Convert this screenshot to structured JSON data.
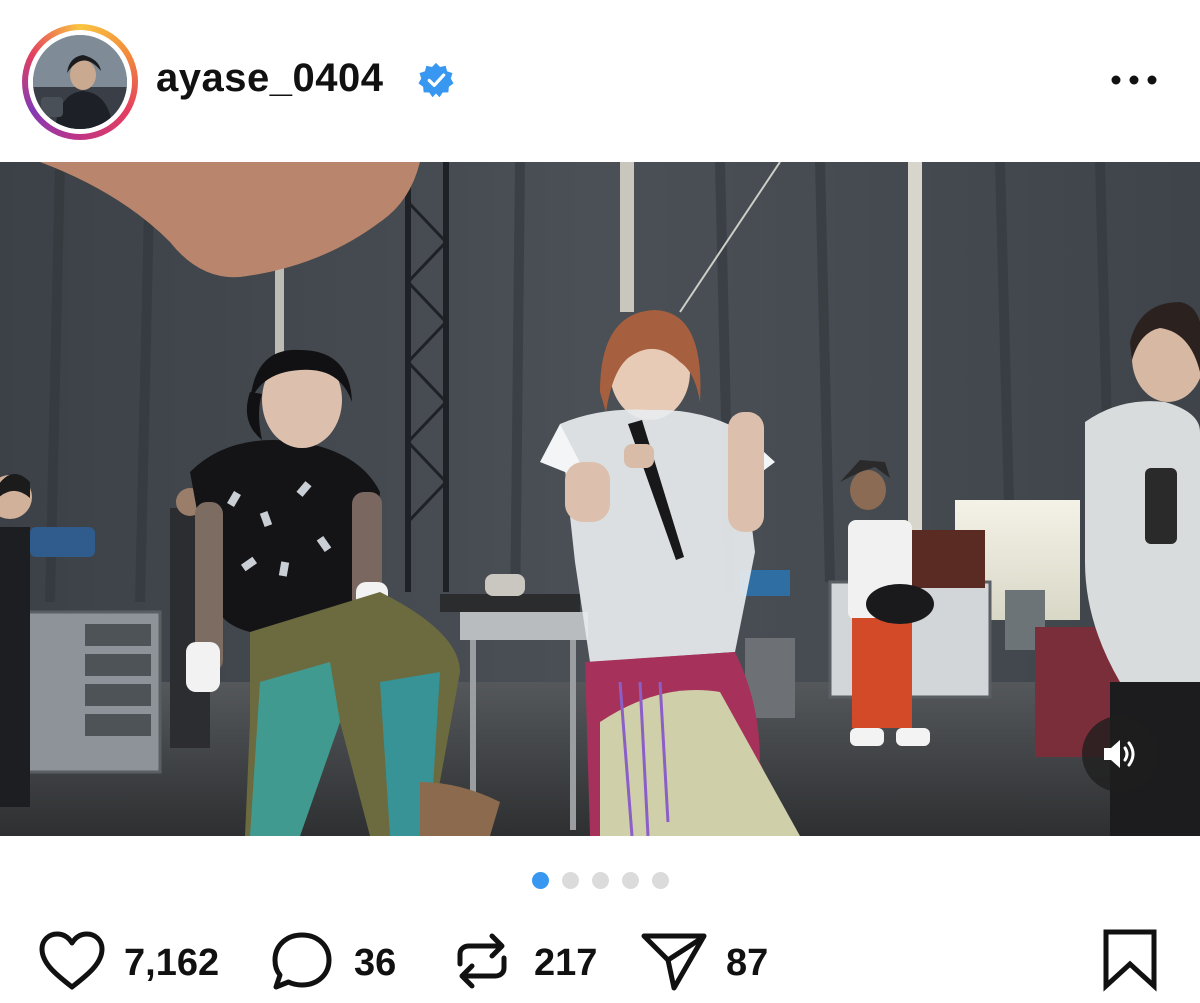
{
  "post": {
    "username": "ayase_0404",
    "verified": true,
    "avatar_icon": "profile-avatar",
    "more_icon": "more-horizontal-icon"
  },
  "media": {
    "type": "video",
    "sound_icon": "speaker-on-icon",
    "carousel": {
      "count": 5,
      "active_index": 0
    }
  },
  "actions": {
    "likes": "7,162",
    "comments": "36",
    "reposts": "217",
    "shares": "87"
  },
  "icons": {
    "like": "heart-icon",
    "comment": "comment-bubble-icon",
    "repost": "repost-icon",
    "share": "paper-plane-icon",
    "save": "bookmark-icon"
  },
  "colors": {
    "verified_badge": "#3897f0",
    "active_dot": "#3897f0",
    "inactive_dot": "#dbdbdb"
  }
}
